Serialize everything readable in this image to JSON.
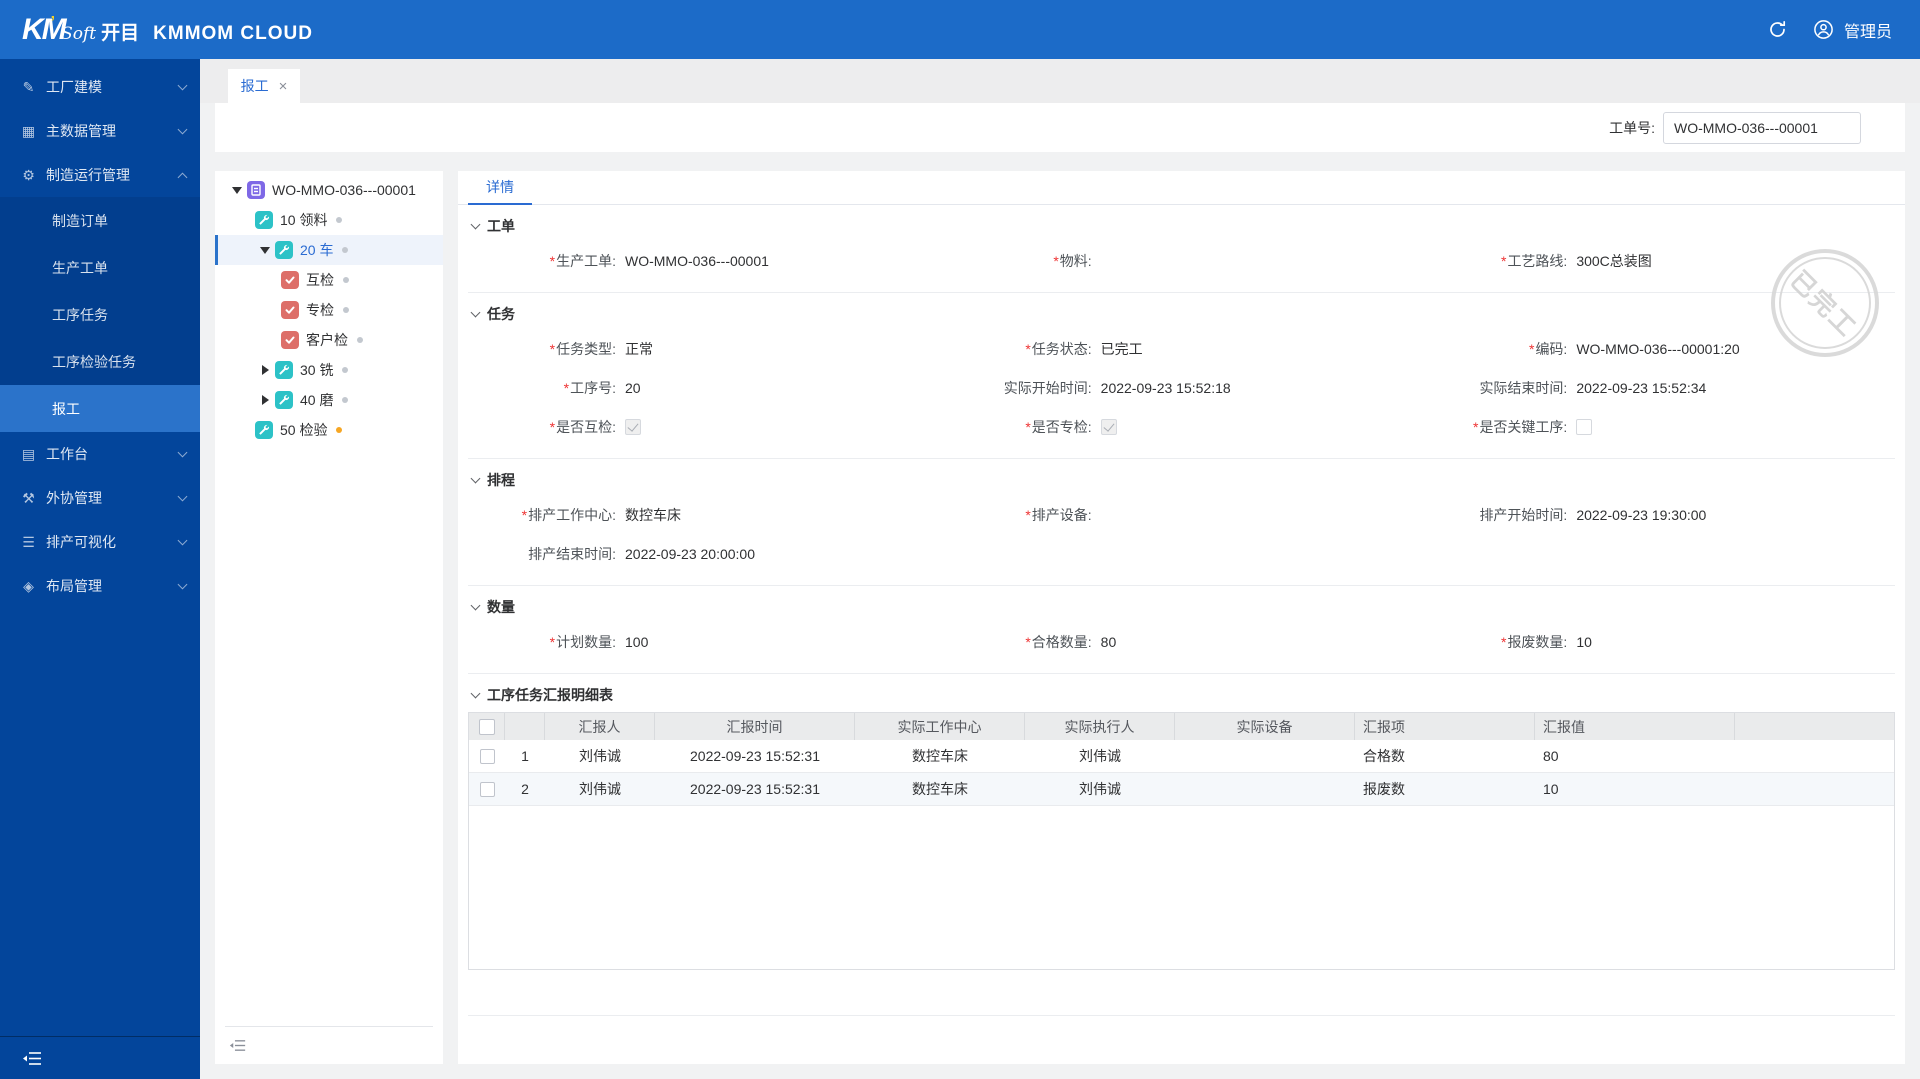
{
  "header": {
    "logo_km": "KM",
    "logo_tick": "’",
    "logo_soft": "Soft",
    "logo_kaimu": "开目",
    "brand": "KMMOM CLOUD",
    "user": "管理员"
  },
  "sidebar": {
    "items": [
      {
        "label": "工厂建模",
        "icon": "pencil-icon",
        "glyph": "✎"
      },
      {
        "label": "主数据管理",
        "icon": "grid-icon",
        "glyph": "▦"
      },
      {
        "label": "制造运行管理",
        "icon": "gear-icon",
        "glyph": "⚙"
      },
      {
        "label": "工作台",
        "icon": "clipboard-icon",
        "glyph": "▤"
      },
      {
        "label": "外协管理",
        "icon": "tools-icon",
        "glyph": "⚒"
      },
      {
        "label": "排产可视化",
        "icon": "list-icon",
        "glyph": "☰"
      },
      {
        "label": "布局管理",
        "icon": "cube-icon",
        "glyph": "◈"
      }
    ],
    "submenu": [
      {
        "label": "制造订单"
      },
      {
        "label": "生产工单"
      },
      {
        "label": "工序任务"
      },
      {
        "label": "工序检验任务"
      },
      {
        "label": "报工"
      }
    ]
  },
  "tabs": {
    "active": "报工",
    "close": "×"
  },
  "toolbar": {
    "wo_label": "工单号:",
    "wo_value": "WO-MMO-036---00001"
  },
  "tree": {
    "items": [
      {
        "label": "WO-MMO-036---00001"
      },
      {
        "label": "10 领料"
      },
      {
        "label": "20 车"
      },
      {
        "label": "互检"
      },
      {
        "label": "专检"
      },
      {
        "label": "客户检"
      },
      {
        "label": "30 铣"
      },
      {
        "label": "40 磨"
      },
      {
        "label": "50 检验"
      }
    ]
  },
  "detail": {
    "tab": "详情",
    "stamp": "已完工",
    "sections": {
      "workorder": {
        "title": "工单",
        "fields": [
          {
            "req": "*",
            "label": "生产工单:",
            "value": "WO-MMO-036---00001"
          },
          {
            "req": "*",
            "label": "物料:",
            "value": ""
          },
          {
            "req": "*",
            "label": "工艺路线:",
            "value": "300C总装图"
          }
        ]
      },
      "task": {
        "title": "任务",
        "fields": [
          {
            "req": "*",
            "label": "任务类型:",
            "value": "正常"
          },
          {
            "req": "*",
            "label": "任务状态:",
            "value": "已完工"
          },
          {
            "req": "*",
            "label": "编码:",
            "value": "WO-MMO-036---00001:20"
          },
          {
            "req": "*",
            "label": "工序号:",
            "value": "20"
          },
          {
            "req": "",
            "label": "实际开始时间:",
            "value": "2022-09-23 15:52:18"
          },
          {
            "req": "",
            "label": "实际结束时间:",
            "value": "2022-09-23 15:52:34"
          },
          {
            "req": "*",
            "label": "是否互检:",
            "value": ""
          },
          {
            "req": "*",
            "label": "是否专检:",
            "value": ""
          },
          {
            "req": "*",
            "label": "是否关键工序:",
            "value": ""
          }
        ]
      },
      "schedule": {
        "title": "排程",
        "fields": [
          {
            "req": "*",
            "label": "排产工作中心:",
            "value": "数控车床"
          },
          {
            "req": "*",
            "label": "排产设备:",
            "value": ""
          },
          {
            "req": "",
            "label": "排产开始时间:",
            "value": "2022-09-23 19:30:00"
          },
          {
            "req": "",
            "label": "排产结束时间:",
            "value": "2022-09-23 20:00:00"
          }
        ]
      },
      "quantity": {
        "title": "数量",
        "fields": [
          {
            "req": "*",
            "label": "计划数量:",
            "value": "100"
          },
          {
            "req": "*",
            "label": "合格数量:",
            "value": "80"
          },
          {
            "req": "*",
            "label": "报废数量:",
            "value": "10"
          }
        ]
      }
    }
  },
  "report_table": {
    "title": "工序任务汇报明细表",
    "columns": [
      "汇报人",
      "汇报时间",
      "实际工作中心",
      "实际执行人",
      "实际设备",
      "汇报项",
      "汇报值"
    ],
    "rows": [
      {
        "idx": "1",
        "reporter": "刘伟诚",
        "time": "2022-09-23 15:52:31",
        "work_center": "数控车床",
        "executor": "刘伟诚",
        "device": "",
        "item": "合格数",
        "value": "80"
      },
      {
        "idx": "2",
        "reporter": "刘伟诚",
        "time": "2022-09-23 15:52:31",
        "work_center": "数控车床",
        "executor": "刘伟诚",
        "device": "",
        "item": "报废数",
        "value": "10"
      }
    ]
  }
}
